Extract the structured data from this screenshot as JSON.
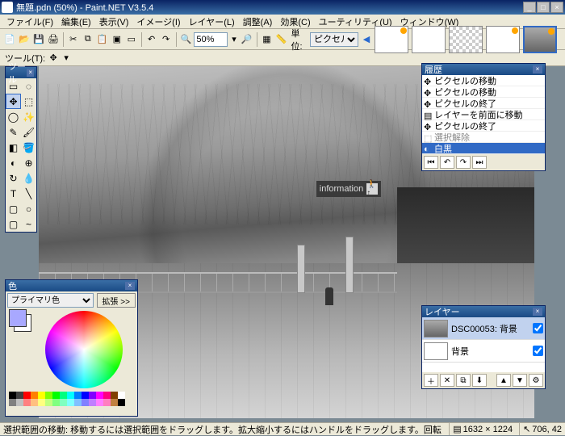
{
  "title": "無題.pdn (50%) - Paint.NET V3.5.4",
  "menu": [
    "ファイル(F)",
    "編集(E)",
    "表示(V)",
    "イメージ(I)",
    "レイヤー(L)",
    "調整(A)",
    "効果(C)",
    "ユーティリティ(U)",
    "ウィンドウ(W)"
  ],
  "toolbar": {
    "zoom": "50%",
    "unit_label": "単位:",
    "unit_value": "ピクセル"
  },
  "tool_options_label": "ツール(T):",
  "tools_panel": {
    "title": "ツール"
  },
  "history_panel": {
    "title": "履歴",
    "items": [
      {
        "label": "ピクセルの移動",
        "dim": false
      },
      {
        "label": "ピクセルの移動",
        "dim": false
      },
      {
        "label": "ピクセルの終了",
        "dim": false
      },
      {
        "label": "レイヤーを前面に移動",
        "dim": false
      },
      {
        "label": "ピクセルの終了",
        "dim": false
      },
      {
        "label": "選択解除",
        "dim": true
      },
      {
        "label": "白黒",
        "sel": true
      }
    ]
  },
  "layers_panel": {
    "title": "レイヤー",
    "items": [
      {
        "label": "DSC00053: 背景",
        "sel": true,
        "checked": true
      },
      {
        "label": "背景",
        "sel": false,
        "checked": true
      }
    ]
  },
  "colors_panel": {
    "title": "色",
    "primary_label": "プライマリ色",
    "more": "拡張 >>",
    "primary_hex": "#a8a8ff",
    "secondary_hex": "#ffffff",
    "palette": [
      "#000",
      "#404040",
      "#ff0000",
      "#ff8000",
      "#ffff00",
      "#80ff00",
      "#00ff00",
      "#00ff80",
      "#00ffff",
      "#0080ff",
      "#0000ff",
      "#8000ff",
      "#ff00ff",
      "#ff0080",
      "#804000",
      "#fff",
      "#808080",
      "#c0c0c0",
      "#ff8080",
      "#ffc080",
      "#ffff80",
      "#c0ff80",
      "#80ff80",
      "#80ffc0",
      "#80ffff",
      "#80c0ff",
      "#8080ff",
      "#c080ff",
      "#ff80ff",
      "#ff80c0",
      "#c08040",
      "#000"
    ]
  },
  "canvas_sign": "information",
  "status": {
    "text": "選択範囲の移動: 移動するには選択範囲をドラッグします。拡大縮小するにはハンドルをドラッグします。回転するにはマウスの右ボタンでドラッグ",
    "dims": "1632 × 1224",
    "pos": "706, 42"
  }
}
